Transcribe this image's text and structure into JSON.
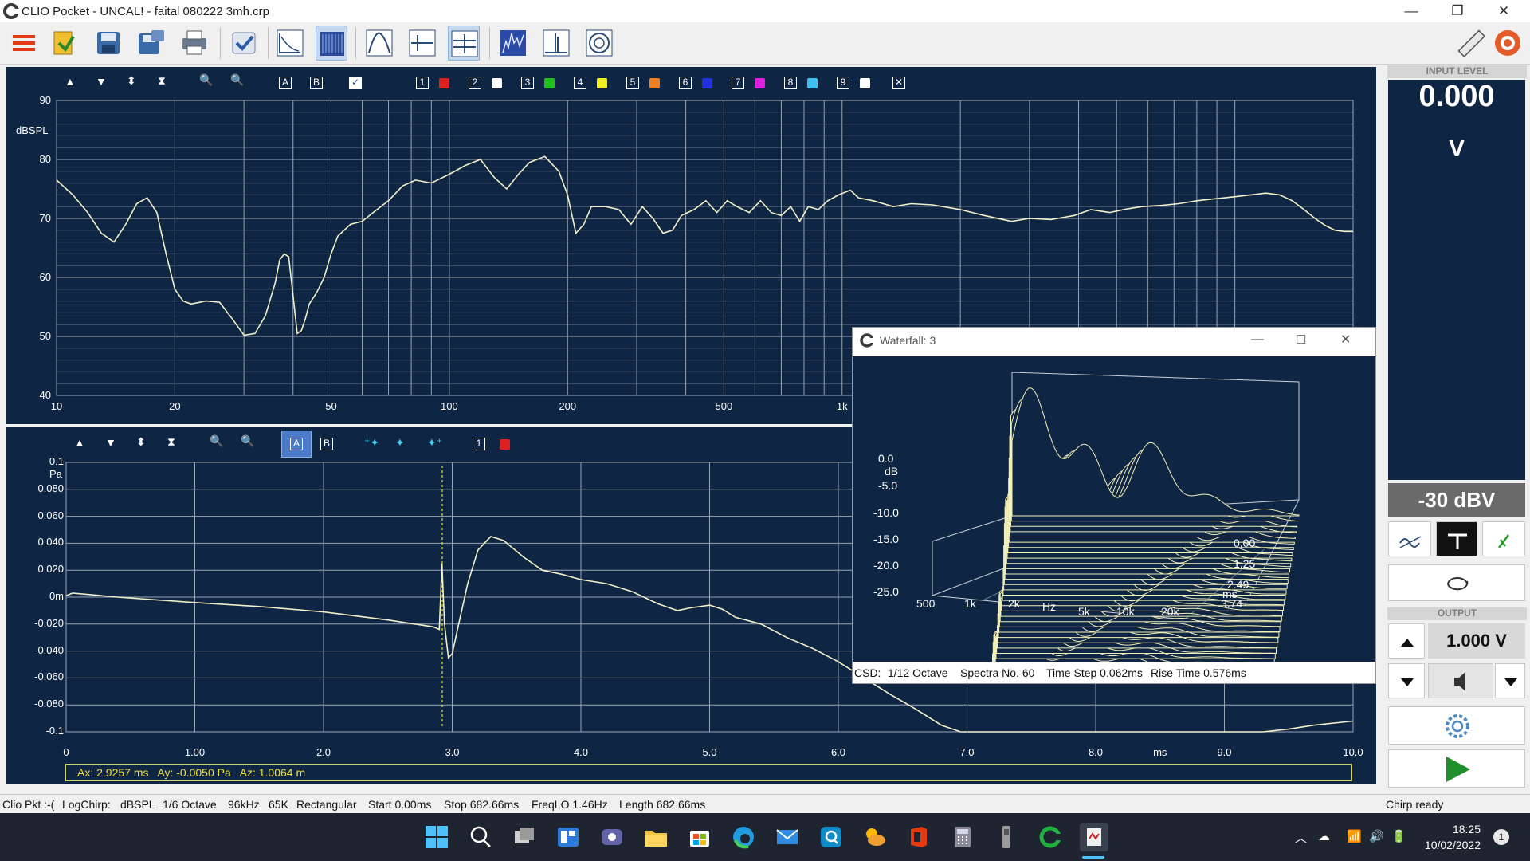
{
  "window": {
    "title": "CLIO Pocket - UNCAL! - faital 080222 3mh.crp",
    "min": "—",
    "max": "❐",
    "close": "✕"
  },
  "toolbar": {
    "items": [
      "menu-icon",
      "open-icon",
      "save-icon",
      "save-as-icon",
      "print-icon",
      "check-icon",
      "fft-icon",
      "spectrum-icon",
      "frequency-response-icon",
      "impedance-icon",
      "waveform-icon",
      "waterfall-icon",
      "impulse-icon",
      "polar-icon",
      "ruler-icon",
      "help-icon"
    ]
  },
  "top_graph": {
    "unit": "dBSPL",
    "buttons": {
      "a": "A",
      "b": "B"
    },
    "memories": [
      {
        "n": "1",
        "color": "#e02020"
      },
      {
        "n": "2",
        "color": "#ffffff"
      },
      {
        "n": "3",
        "color": "#20c020"
      },
      {
        "n": "4",
        "color": "#f0f020"
      },
      {
        "n": "5",
        "color": "#f08020"
      },
      {
        "n": "6",
        "color": "#2030e0"
      },
      {
        "n": "7",
        "color": "#e020e0"
      },
      {
        "n": "8",
        "color": "#40c0f0"
      },
      {
        "n": "9",
        "color": "#ffffff"
      }
    ],
    "close_glyph": "✕",
    "y_ticks": [
      "90",
      "80",
      "70",
      "60",
      "50",
      "40"
    ],
    "x_ticks": [
      "10",
      "20",
      "50",
      "100",
      "200",
      "500",
      "1k"
    ]
  },
  "bottom_graph": {
    "unit": "Pa",
    "buttons": {
      "a": "A",
      "b": "B",
      "mem1": "1"
    },
    "y_ticks": [
      "0.1",
      "0.080",
      "0.060",
      "0.040",
      "0.020",
      "0m",
      "-0.020",
      "-0.040",
      "-0.060",
      "-0.080",
      "-0.1"
    ],
    "x_ticks": [
      "0",
      "1.00",
      "2.0",
      "3.0",
      "4.0",
      "5.0",
      "6.0",
      "7.0",
      "8.0",
      "ms",
      "9.0",
      "10.0"
    ],
    "cursor_readout": "Ax: 2.9257 ms   Ay: -0.0050 Pa   Az: 1.0064 m"
  },
  "right_panel": {
    "input_label": "INPUT LEVEL",
    "input_value": "0.000",
    "input_unit": "V",
    "input_range": "-30 dBV",
    "output_label": "OUTPUT",
    "output_value": "1.000 V"
  },
  "waterfall": {
    "title": "Waterfall: 3",
    "db_ticks": [
      "0.0",
      "dB",
      "-5.0",
      "-10.0",
      "-15.0",
      "-20.0",
      "-25.0"
    ],
    "freq_ticks": [
      "500",
      "1k",
      "2k",
      "Hz",
      "5k",
      "10k",
      "20k"
    ],
    "time_ticks": [
      "0.00",
      "1.25",
      "2.49",
      "ms",
      "3.74"
    ],
    "status": {
      "csd": "CSD:",
      "octave": "1/12 Octave",
      "spectra": "Spectra No. 60",
      "step": "Time Step 0.062ms",
      "rise": "Rise Time 0.576ms"
    }
  },
  "status_bar": {
    "items": [
      "Clio Pkt :-(",
      "LogChirp:",
      "dBSPL",
      "1/6 Octave",
      "96kHz",
      "65K",
      "Rectangular",
      "Start 0.00ms",
      "Stop 682.66ms",
      "FreqLO 1.46Hz",
      "Length 682.66ms"
    ],
    "right": "Chirp ready"
  },
  "taskbar": {
    "time": "18:25",
    "date": "10/02/2022",
    "notifications": "1"
  },
  "colors": {
    "graph_bg": "#0f2544",
    "trace": "#f2f0c8",
    "grid": "#c8cfd8",
    "accent": "#1e8f2a"
  }
}
